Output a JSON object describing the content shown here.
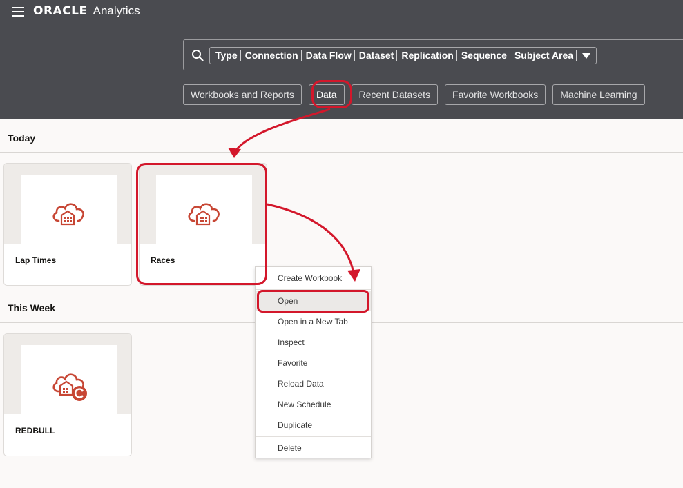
{
  "header": {
    "brand_logo": "ORACLE",
    "brand_product": "Analytics",
    "menu_icon": "hamburger-icon",
    "search_icon": "search-icon"
  },
  "search": {
    "types": [
      "Type",
      "Connection",
      "Data Flow",
      "Dataset",
      "Replication",
      "Sequence",
      "Subject Area"
    ]
  },
  "filters": [
    {
      "label": "Workbooks and Reports",
      "active": false
    },
    {
      "label": "Data",
      "active": true
    },
    {
      "label": "Recent Datasets",
      "active": false
    },
    {
      "label": "Favorite Workbooks",
      "active": false
    },
    {
      "label": "Machine Learning",
      "active": false
    }
  ],
  "sections": {
    "today": {
      "title": "Today",
      "items": [
        {
          "name": "Lap Times",
          "icon": "cloud-dataset-icon"
        },
        {
          "name": "Races",
          "icon": "cloud-dataset-icon"
        }
      ]
    },
    "this_week": {
      "title": "This Week",
      "items": [
        {
          "name": "REDBULL",
          "icon": "cloud-dataset-replicated-icon"
        }
      ]
    }
  },
  "context_menu": {
    "items": [
      "Create Workbook",
      "Open",
      "Open in a New Tab",
      "Inspect",
      "Favorite",
      "Reload Data",
      "New Schedule",
      "Duplicate",
      "Delete"
    ],
    "selected": "Open"
  },
  "colors": {
    "header_bg": "#4a4b50",
    "accent_red": "#c74634",
    "annotation_red": "#d3172b",
    "page_bg": "#fbf9f8"
  }
}
